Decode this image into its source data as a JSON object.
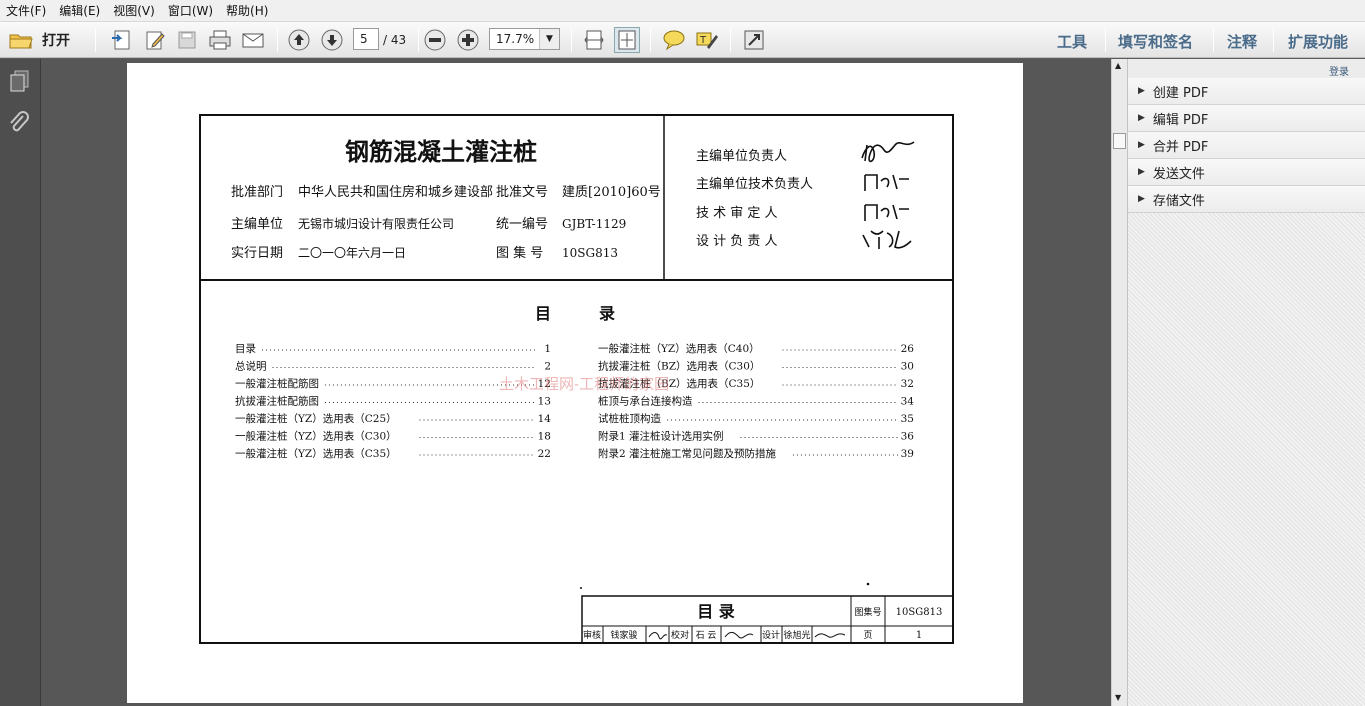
{
  "menu": [
    "文件(F)",
    "编辑(E)",
    "视图(V)",
    "窗口(W)",
    "帮助(H)"
  ],
  "toolbar": {
    "open_label": "打开",
    "page_current": "5",
    "page_total": "/ 43",
    "zoom": "17.7%"
  },
  "right_buttons": [
    "工具",
    "填写和签名",
    "注释",
    "扩展功能"
  ],
  "right_pane": {
    "login": "登录",
    "items": [
      "创建 PDF",
      "编辑 PDF",
      "合并 PDF",
      "发送文件",
      "存储文件"
    ]
  },
  "document": {
    "title": "钢筋混凝土灌注桩",
    "approve_dept_label": "批准部门",
    "approve_dept": "中华人民共和国住房和城乡建设部",
    "approve_no_label": "批准文号",
    "approve_no": "建质[2010]60号",
    "editor_label": "主编单位",
    "editor": "无锡市城归设计有限责任公司",
    "unified_no_label": "统一编号",
    "unified_no": "GJBT-1129",
    "date_label": "实行日期",
    "date": "二〇一〇年六月一日",
    "atlas_no_label": "图 集 号",
    "atlas_no": "10SG813",
    "roles": [
      "主编单位负责人",
      "主编单位技术负责人",
      "技 术 审 定 人",
      "设 计 负 责 人"
    ],
    "toc_title_a": "目",
    "toc_title_b": "录",
    "toc_left": [
      {
        "name": "目录",
        "page": "1"
      },
      {
        "name": "总说明",
        "page": "2"
      },
      {
        "name": "一般灌注桩配筋图",
        "page": "12"
      },
      {
        "name": "抗拔灌注桩配筋图",
        "page": "13"
      },
      {
        "name": "一般灌注桩（YZ）选用表（C25）",
        "page": "14"
      },
      {
        "name": "一般灌注桩（YZ）选用表（C30）",
        "page": "18"
      },
      {
        "name": "一般灌注桩（YZ）选用表（C35）",
        "page": "22"
      }
    ],
    "toc_right": [
      {
        "name": "一般灌注桩（YZ）选用表（C40）",
        "page": "26"
      },
      {
        "name": "抗拔灌注桩（BZ）选用表（C30）",
        "page": "30"
      },
      {
        "name": "抗拔灌注桩（BZ）选用表（C35）",
        "page": "32"
      },
      {
        "name": "桩顶与承台连接构造",
        "page": "34"
      },
      {
        "name": "试桩桩顶构造",
        "page": "35"
      },
      {
        "name": "附录1 灌注桩设计选用实例",
        "page": "36"
      },
      {
        "name": "附录2 灌注桩施工常见问题及预防措施",
        "page": "39"
      }
    ],
    "watermark": "土木工程网-工程师的家园",
    "titleblock": {
      "name": "目  录",
      "atlas_label": "图集号",
      "atlas_no": "10SG813",
      "review": "审核",
      "reviewer": "钱家骏",
      "check": "校对",
      "checker": "石 云",
      "design": "设计",
      "designer": "徐旭光",
      "page_label": "页",
      "page_no": "1"
    }
  },
  "colors": {
    "accent": "#4a6b8a",
    "watermark": "#e07a7a"
  }
}
